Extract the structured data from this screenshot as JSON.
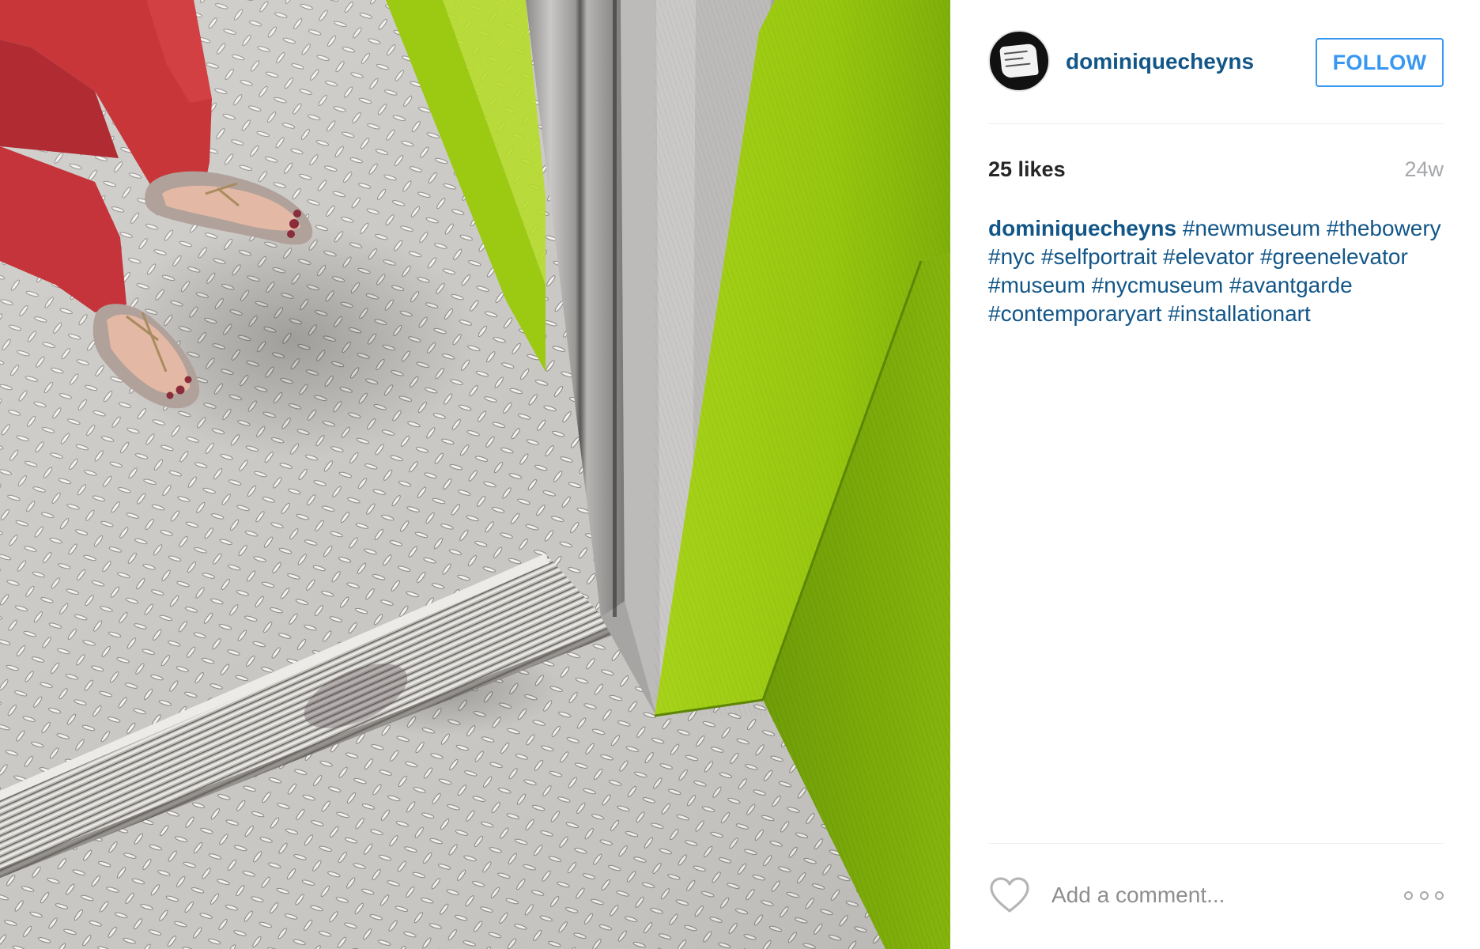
{
  "post": {
    "photo_alt": "",
    "author": {
      "username": "dominiquecheyns",
      "avatar_icon": "avatar-graffiti-logo-icon"
    },
    "follow_label": "FOLLOW",
    "likes": "25 likes",
    "age": "24w",
    "caption": {
      "username": "dominiquecheyns",
      "hashtags": [
        "#newmuseum",
        "#thebowery",
        "#nyc",
        "#selfportrait",
        "#elevator",
        "#greenelevator",
        "#museum",
        "#nycmuseum",
        "#avantgarde",
        "#contemporaryart",
        "#installationart"
      ]
    },
    "comment": {
      "placeholder": "Add a comment..."
    },
    "icons": {
      "like": "heart-icon",
      "more": "more-options-icon"
    },
    "colors": {
      "link": "#125688",
      "follow": "#3897f0",
      "muted": "#a5a7aa"
    }
  }
}
